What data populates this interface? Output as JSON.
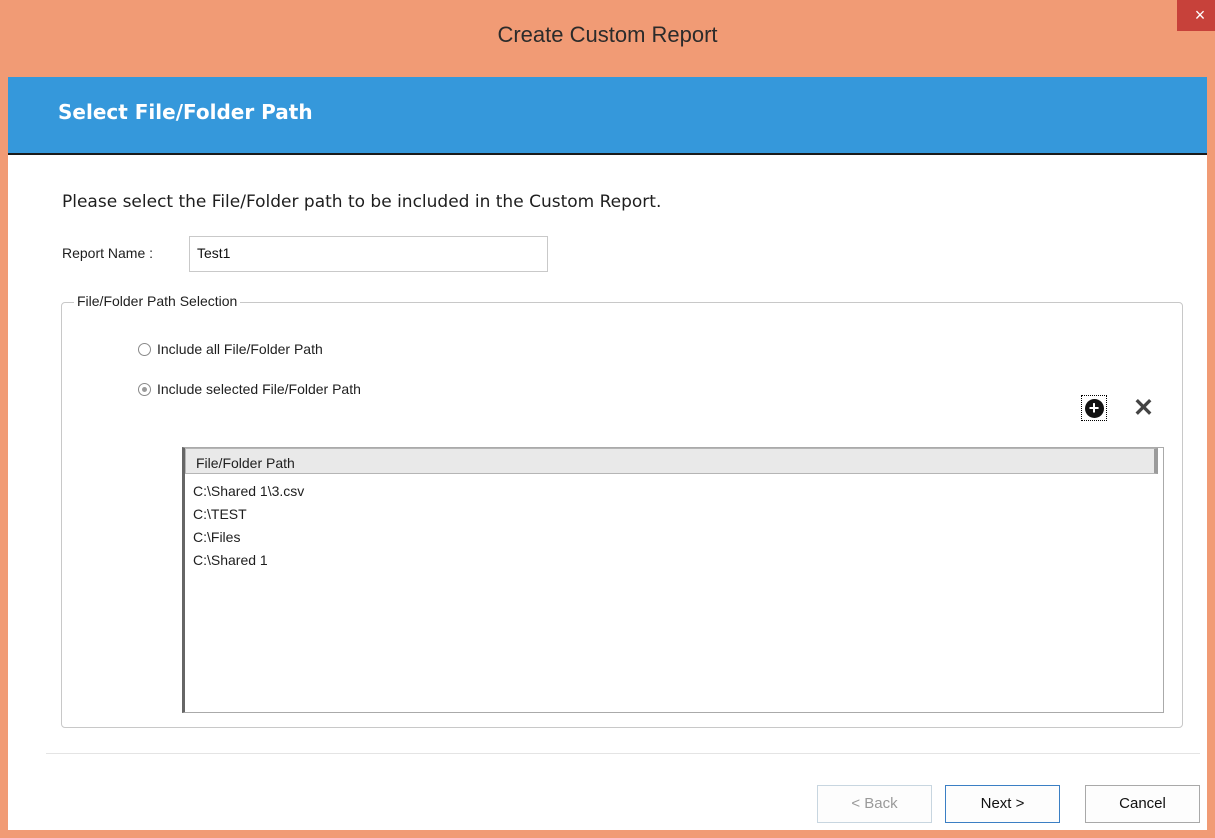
{
  "window": {
    "title": "Create Custom Report",
    "close_symbol": "×"
  },
  "banner": {
    "title": "Select File/Folder Path"
  },
  "instructions": "Please select the File/Folder path to be included in the Custom Report.",
  "report_name": {
    "label": "Report Name :",
    "value": "Test1"
  },
  "path_selection": {
    "legend": "File/Folder Path Selection",
    "options": [
      {
        "label": "Include all File/Folder Path",
        "checked": false
      },
      {
        "label": "Include selected File/Folder Path",
        "checked": true
      }
    ],
    "add_icon": "add-icon",
    "remove_icon": "remove-icon",
    "remove_symbol": "✕"
  },
  "path_list": {
    "header": "File/Folder Path",
    "rows": [
      "C:\\Shared 1\\3.csv",
      "C:\\TEST",
      "C:\\Files",
      "C:\\Shared 1"
    ]
  },
  "footer": {
    "back_label": "< Back",
    "next_label": "Next >",
    "cancel_label": "Cancel"
  }
}
